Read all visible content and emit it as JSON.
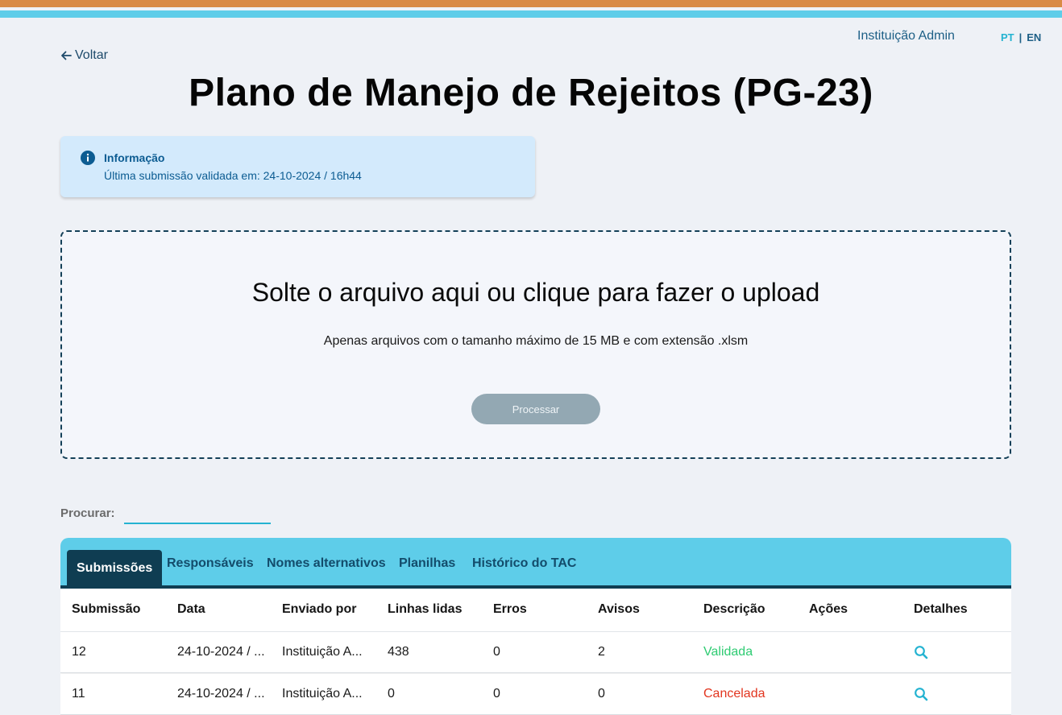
{
  "header": {
    "user_name": "Instituição Admin",
    "lang_pt": "PT",
    "lang_separator": "|",
    "lang_en": "EN"
  },
  "nav": {
    "back_label": "Voltar"
  },
  "page": {
    "title": "Plano de Manejo de Rejeitos (PG-23)"
  },
  "info": {
    "title": "Informação",
    "text": "Última submissão validada em: 24-10-2024 / 16h44"
  },
  "upload": {
    "title": "Solte o arquivo aqui ou clique para fazer o upload",
    "subtitle": "Apenas arquivos com o tamanho máximo de 15 MB e com extensão .xlsm",
    "button_label": "Processar"
  },
  "search": {
    "label": "Procurar:",
    "value": ""
  },
  "tabs": [
    {
      "label": "Submissões",
      "active": true
    },
    {
      "label": "Responsáveis"
    },
    {
      "label": "Nomes alternativos"
    },
    {
      "label": "Planilhas"
    },
    {
      "label": "Histórico do TAC"
    }
  ],
  "table": {
    "columns": [
      "Submissão",
      "Data",
      "Enviado por",
      "Linhas lidas",
      "Erros",
      "Avisos",
      "Descrição",
      "Ações",
      "Detalhes"
    ],
    "rows": [
      {
        "submission": "12",
        "date": "24-10-2024 / ...",
        "sent_by": "Instituição A...",
        "lines": "438",
        "errors": "0",
        "warnings": "2",
        "description": "Validada",
        "actions": "",
        "details_icon": "search-icon"
      },
      {
        "submission": "11",
        "date": "24-10-2024 / ...",
        "sent_by": "Instituição A...",
        "lines": "0",
        "errors": "0",
        "warnings": "0",
        "description": "Cancelada",
        "actions": "",
        "details_icon": "search-icon"
      }
    ]
  },
  "colors": {
    "accent_orange": "#d98a45",
    "accent_cyan": "#5fcde9",
    "tab_active": "#0f3d52",
    "status_validated": "#2ecb72",
    "status_cancelled": "#e2351f"
  }
}
